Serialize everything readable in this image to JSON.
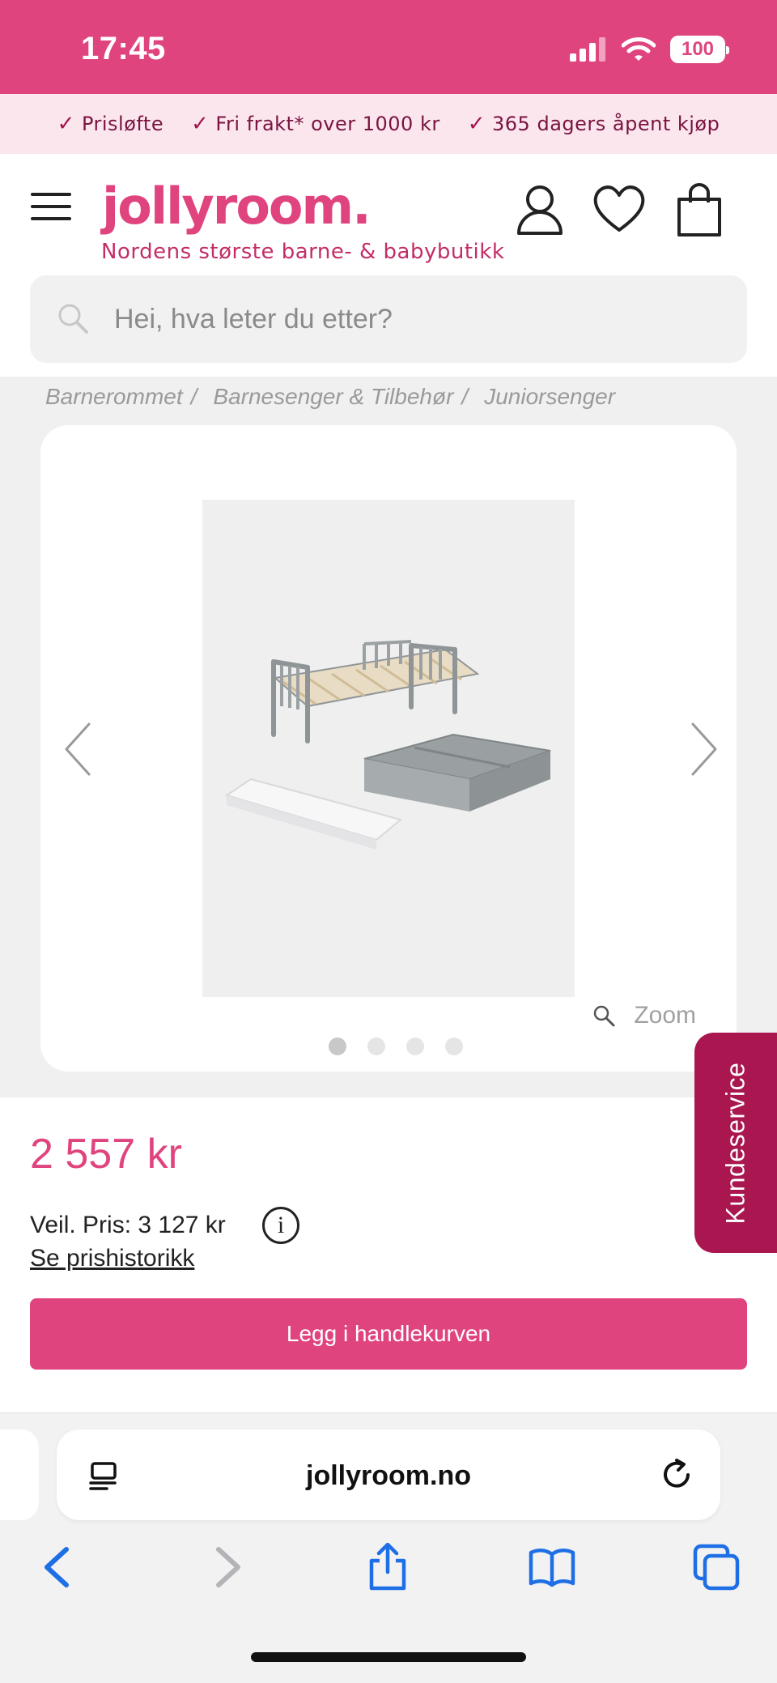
{
  "status_bar": {
    "time": "17:45",
    "battery": "100"
  },
  "usp_bar": {
    "items": [
      "Prisløfte",
      "Fri frakt* over 1000 kr",
      "365 dagers åpent kjøp"
    ]
  },
  "header": {
    "logo": "jollyroom.",
    "tagline": "Nordens største barne- & babybutikk",
    "icons": [
      "menu-icon",
      "user-icon",
      "heart-icon",
      "bag-icon"
    ]
  },
  "search": {
    "placeholder": "Hei, hva leter du etter?"
  },
  "breadcrumb": {
    "items": [
      "Barnerommet",
      "Barnesenger & Tilbehør",
      "Juniorsenger"
    ],
    "separator": "/"
  },
  "gallery": {
    "zoom_label": "Zoom",
    "image_count": 4,
    "active_index": 0
  },
  "product": {
    "price": "2 557 kr",
    "rrp": "Veil. Pris: 3 127 kr",
    "price_history_link": "Se prishistorikk",
    "add_to_cart_label": "Legg i handlekurven"
  },
  "kundeservice": {
    "label": "Kundeservice"
  },
  "browser": {
    "url": "jollyroom.no"
  },
  "colors": {
    "brand_pink": "#e0447f",
    "dark_pink": "#a91650",
    "ios_blue": "#1e6fe6"
  }
}
